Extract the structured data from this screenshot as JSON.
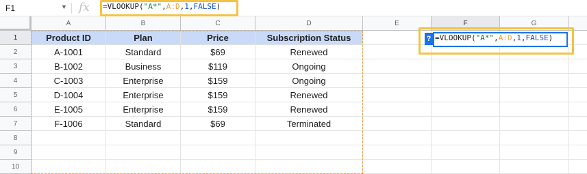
{
  "namebox": {
    "value": "F1"
  },
  "formula": {
    "prefix": "=VLOOKUP(",
    "string_arg": "\"A*\"",
    "sep1": ",",
    "range_arg": "A:D",
    "sep2": ",",
    "index_arg": "1",
    "sep3": ",",
    "bool_arg": "FALSE",
    "suffix": ")"
  },
  "columns": [
    "A",
    "B",
    "C",
    "D",
    "E",
    "F",
    "G"
  ],
  "rows": [
    "1",
    "2",
    "3",
    "4",
    "5",
    "6",
    "7",
    "8",
    "9",
    "10"
  ],
  "table": {
    "headers": [
      "Product ID",
      "Plan",
      "Price",
      "Subscription Status"
    ],
    "data": [
      [
        "A-1001",
        "Standard",
        "$69",
        "Renewed"
      ],
      [
        "B-1002",
        "Business",
        "$119",
        "Ongoing"
      ],
      [
        "C-1003",
        "Enterprise",
        "$159",
        "Ongoing"
      ],
      [
        "D-1004",
        "Enterprise",
        "$159",
        "Renewed"
      ],
      [
        "E-1005",
        "Enterprise",
        "$159",
        "Renewed"
      ],
      [
        "F-1006",
        "Standard",
        "$69",
        "Terminated"
      ]
    ]
  },
  "editor": {
    "help_label": "?"
  },
  "colors": {
    "header_fill": "#c9daf8",
    "highlight": "#f5c242",
    "range_outline": "#f29c38",
    "editor_border": "#1a73e8"
  }
}
